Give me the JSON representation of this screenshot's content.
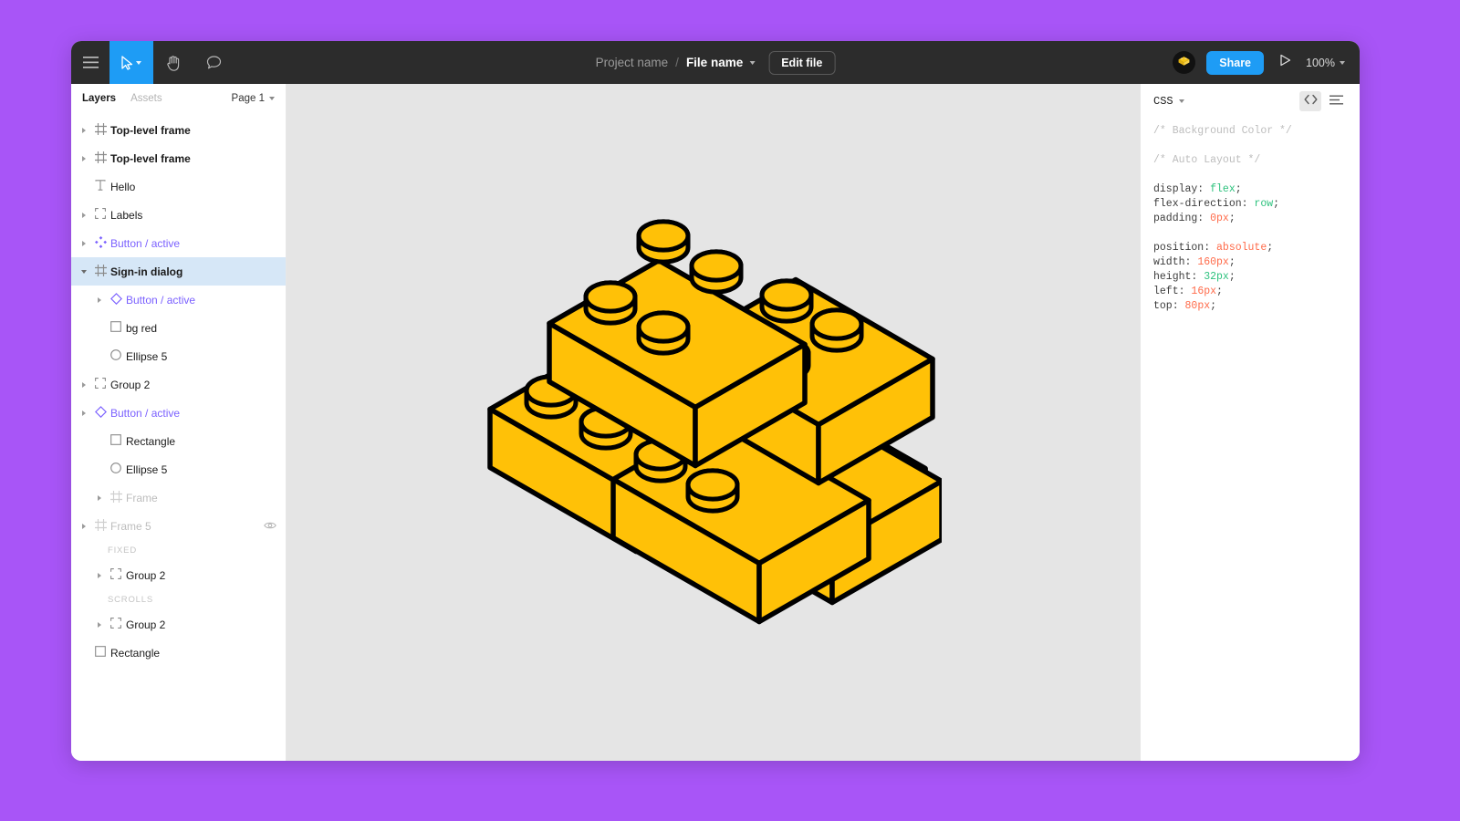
{
  "window": {
    "background_color": "#a855f7",
    "canvas_color": "#e5e5e5",
    "toolbar_color": "#2c2c2c",
    "accent_color": "#1e9cf5",
    "component_color": "#7b61ff",
    "selection_color": "#d6e7f7"
  },
  "toolbar": {
    "menu_icon": "hamburger-menu-icon",
    "move_tool_icon": "cursor-move-icon",
    "move_tool_caret_icon": "chevron-down-icon",
    "hand_tool_icon": "hand-tool-icon",
    "comment_tool_icon": "comment-bubble-icon",
    "project_name": "Project name",
    "path_separator": "/",
    "file_name": "File name",
    "file_caret_icon": "chevron-down-icon",
    "edit_file_label": "Edit file",
    "avatar_icon": "lego-brick-avatar-icon",
    "share_label": "Share",
    "present_icon": "play-present-icon",
    "zoom_level": "100%",
    "zoom_caret_icon": "chevron-down-icon"
  },
  "sidebar": {
    "tabs": [
      {
        "label": "Layers",
        "active": true
      },
      {
        "label": "Assets",
        "active": false
      }
    ],
    "page_selector": {
      "label": "Page 1",
      "caret_icon": "chevron-down-icon"
    },
    "layers": [
      {
        "kind": "layer",
        "label": "Top-level frame",
        "icon": "frame-icon",
        "indent": 0,
        "disclosure": "closed",
        "style": "bold",
        "name": "top-level-frame-1"
      },
      {
        "kind": "layer",
        "label": "Top-level frame",
        "icon": "frame-icon",
        "indent": 0,
        "disclosure": "closed",
        "style": "bold",
        "name": "top-level-frame-2"
      },
      {
        "kind": "layer",
        "label": "Hello",
        "icon": "text-icon",
        "indent": 0,
        "disclosure": "none",
        "style": "normal",
        "name": "text-hello"
      },
      {
        "kind": "layer",
        "label": "Labels",
        "icon": "group-icon",
        "indent": 0,
        "disclosure": "closed",
        "style": "normal",
        "name": "group-labels"
      },
      {
        "kind": "layer",
        "label": "Button / active",
        "icon": "component-set-icon",
        "indent": 0,
        "disclosure": "closed",
        "style": "component",
        "name": "component-set-button-active"
      },
      {
        "kind": "layer",
        "label": "Sign-in dialog",
        "icon": "frame-icon",
        "indent": 0,
        "disclosure": "open",
        "style": "bold",
        "selected": true,
        "name": "frame-sign-in-dialog"
      },
      {
        "kind": "layer",
        "label": "Button / active",
        "icon": "component-icon",
        "indent": 1,
        "disclosure": "closed",
        "style": "component",
        "name": "component-button-active-1"
      },
      {
        "kind": "layer",
        "label": "bg red",
        "icon": "rectangle-icon",
        "indent": 1,
        "disclosure": "none",
        "style": "normal",
        "name": "rectangle-bg-red"
      },
      {
        "kind": "layer",
        "label": "Ellipse 5",
        "icon": "ellipse-icon",
        "indent": 1,
        "disclosure": "none",
        "style": "normal",
        "name": "ellipse-5-a"
      },
      {
        "kind": "layer",
        "label": "Group 2",
        "icon": "group-icon",
        "indent": 0,
        "disclosure": "closed",
        "style": "normal",
        "name": "group-2-a"
      },
      {
        "kind": "layer",
        "label": "Button / active",
        "icon": "component-icon",
        "indent": 0,
        "disclosure": "closed",
        "style": "component",
        "name": "component-button-active-2"
      },
      {
        "kind": "layer",
        "label": "Rectangle",
        "icon": "rectangle-icon",
        "indent": 1,
        "disclosure": "none",
        "style": "normal",
        "name": "rectangle-a"
      },
      {
        "kind": "layer",
        "label": "Ellipse 5",
        "icon": "ellipse-icon",
        "indent": 1,
        "disclosure": "none",
        "style": "normal",
        "name": "ellipse-5-b"
      },
      {
        "kind": "layer",
        "label": "Frame",
        "icon": "frame-icon",
        "indent": 1,
        "disclosure": "closed",
        "style": "dim",
        "name": "frame-nested"
      },
      {
        "kind": "layer",
        "label": "Frame 5",
        "icon": "frame-icon",
        "indent": 0,
        "disclosure": "closed",
        "style": "dim",
        "eye_icon": "eye-visibility-icon",
        "name": "frame-5"
      },
      {
        "kind": "section",
        "label": "FIXED",
        "name": "section-fixed"
      },
      {
        "kind": "layer",
        "label": "Group 2",
        "icon": "group-icon",
        "indent": 1,
        "disclosure": "closed",
        "style": "normal",
        "name": "group-2-fixed"
      },
      {
        "kind": "section",
        "label": "SCROLLS",
        "name": "section-scrolls"
      },
      {
        "kind": "layer",
        "label": "Group 2",
        "icon": "group-icon",
        "indent": 1,
        "disclosure": "closed",
        "style": "normal",
        "name": "group-2-scrolls"
      },
      {
        "kind": "layer",
        "label": "Rectangle",
        "icon": "rectangle-icon",
        "indent": 0,
        "disclosure": "none",
        "style": "normal",
        "name": "rectangle-b"
      }
    ]
  },
  "canvas": {
    "artwork": "isometric-lego-bricks",
    "brick_fill": "#FFC107",
    "brick_stroke": "#000000",
    "cursor_icon": "hand-cursor"
  },
  "inspector": {
    "language": "CSS",
    "language_caret_icon": "chevron-down-icon",
    "code_view_icon": "code-brackets-icon",
    "list_view_icon": "list-lines-icon",
    "code_lines": [
      {
        "type": "comment",
        "text": "/* Background Color */"
      },
      {
        "type": "blank"
      },
      {
        "type": "comment",
        "text": "/* Auto Layout */"
      },
      {
        "type": "blank"
      },
      {
        "type": "decl",
        "prop": "display:",
        "value": "flex",
        "color": "green",
        "end": ";"
      },
      {
        "type": "decl",
        "prop": "flex-direction:",
        "value": "row",
        "color": "green",
        "end": ";"
      },
      {
        "type": "decl",
        "prop": "padding:",
        "value": "0px",
        "color": "red",
        "end": ";"
      },
      {
        "type": "blank"
      },
      {
        "type": "decl",
        "prop": "position:",
        "value": "absolute",
        "color": "red",
        "end": ";"
      },
      {
        "type": "decl",
        "prop": "width:",
        "value": "160px",
        "color": "red",
        "end": ";"
      },
      {
        "type": "decl",
        "prop": "height:",
        "value": "32px",
        "color": "green",
        "end": ";"
      },
      {
        "type": "decl",
        "prop": "left:",
        "value": "16px",
        "color": "red",
        "end": ";"
      },
      {
        "type": "decl",
        "prop": "top:",
        "value": "80px",
        "color": "red",
        "end": ";"
      }
    ]
  }
}
